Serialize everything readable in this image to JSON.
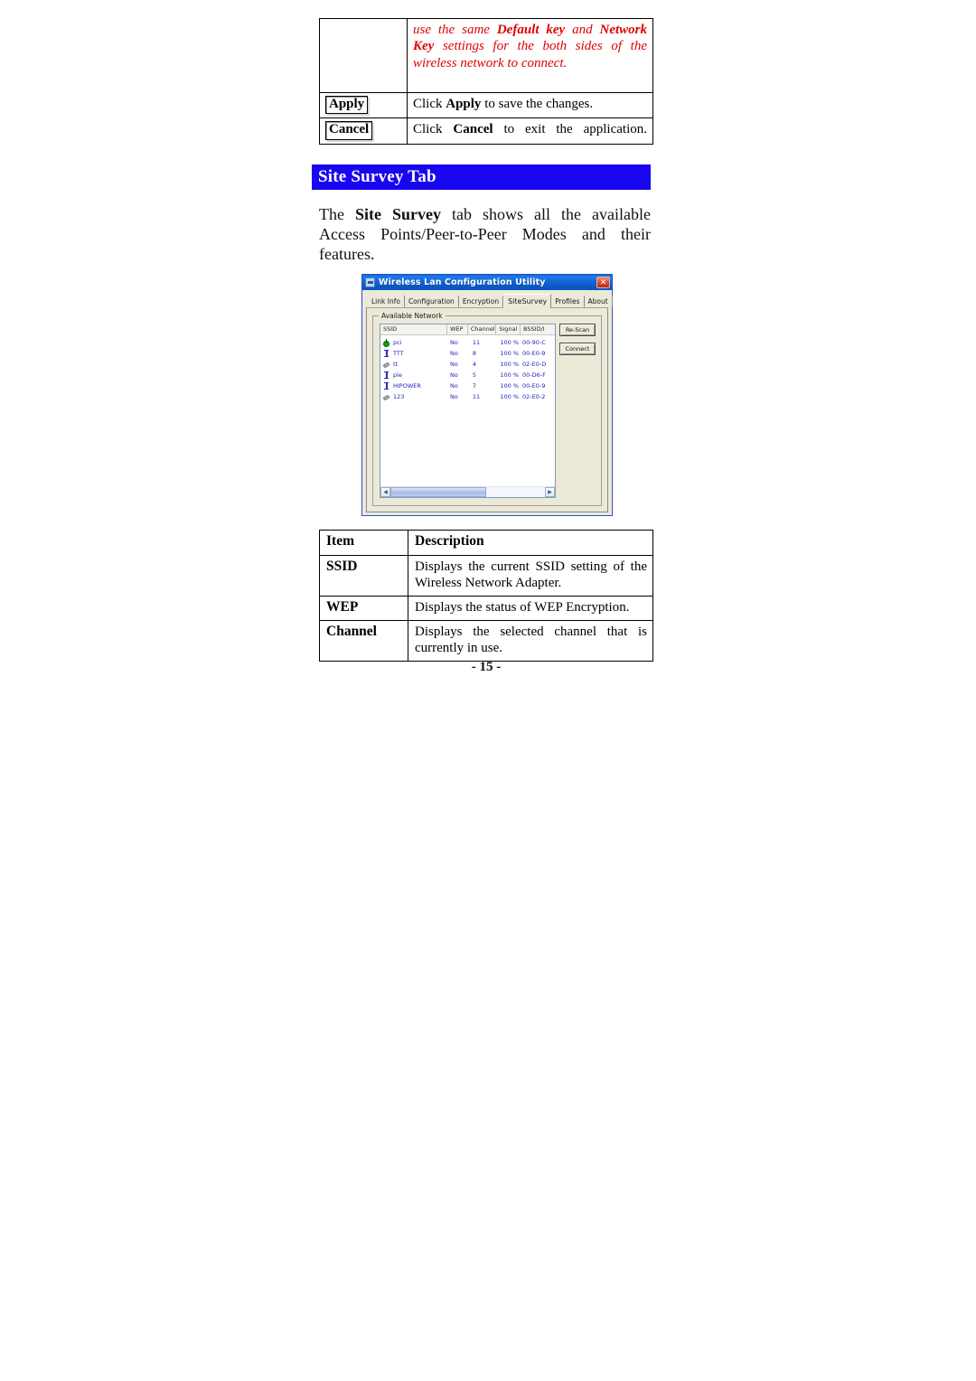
{
  "top_table": {
    "blank_cell": "",
    "red_note_parts": {
      "p1": "use the same ",
      "b1": "Default key",
      "p2": " and ",
      "b2": "Network Key",
      "p3": " settings for the both sides of the wireless network to connect."
    },
    "rows": [
      {
        "item": "Apply",
        "desc_pre": "Click ",
        "desc_bold": "Apply",
        "desc_post": " to save the changes."
      },
      {
        "item": "Cancel",
        "desc_pre": "Click ",
        "desc_bold": "Cancel",
        "desc_post": " to exit the application."
      }
    ]
  },
  "section": {
    "heading": "Site Survey Tab",
    "intro_pre": "The ",
    "intro_bold": "Site Survey",
    "intro_post": " tab shows all the available Access Points/Peer-to-Peer Modes and their features."
  },
  "dialog": {
    "title": "Wireless Lan Configuration Utility",
    "close_label": "✕",
    "tabs": [
      {
        "label": "Link Info",
        "active": false
      },
      {
        "label": "Configuration",
        "active": false
      },
      {
        "label": "Encryption",
        "active": false
      },
      {
        "label": "SiteSurvey",
        "active": true
      },
      {
        "label": "Profiles",
        "active": false
      },
      {
        "label": "About",
        "active": false
      }
    ],
    "groupbox_label": "Available  Network",
    "columns": [
      "SSID",
      "WEP",
      "Channel",
      "Signal",
      "BSSID/I"
    ],
    "networks": [
      {
        "icon": "access-point-icon",
        "ssid": "pci",
        "wep": "No",
        "channel": "11",
        "signal": "100 %",
        "bssid": "00-90-C"
      },
      {
        "icon": "station-icon",
        "ssid": "TTT",
        "wep": "No",
        "channel": "8",
        "signal": "100 %",
        "bssid": "00-E0-9"
      },
      {
        "icon": "peer-to-peer-icon",
        "ssid": "tt",
        "wep": "No",
        "channel": "4",
        "signal": "100 %",
        "bssid": "02-E0-D"
      },
      {
        "icon": "station-icon",
        "ssid": "pie",
        "wep": "No",
        "channel": "5",
        "signal": "100 %",
        "bssid": "00-D6-F"
      },
      {
        "icon": "station-icon",
        "ssid": "HIPOWER",
        "wep": "No",
        "channel": "7",
        "signal": "100 %",
        "bssid": "00-E0-9"
      },
      {
        "icon": "peer-to-peer-icon",
        "ssid": "123",
        "wep": "No",
        "channel": "11",
        "signal": "100 %",
        "bssid": "02-E0-2"
      }
    ],
    "buttons": {
      "rescan": "Re-Scan",
      "connect": "Connect"
    },
    "scrollbar": {
      "left_arrow": "◀",
      "right_arrow": "▶"
    }
  },
  "desc_table": {
    "headers": {
      "item": "Item",
      "description": "Description"
    },
    "rows": [
      {
        "item": "SSID",
        "description": "Displays the current SSID setting of the Wireless Network Adapter."
      },
      {
        "item": "WEP",
        "description": "Displays the status of WEP Encryption."
      },
      {
        "item": "Channel",
        "description": "Displays the selected channel that is currently in use."
      }
    ]
  },
  "footer": {
    "page_number": "- 15 -"
  }
}
